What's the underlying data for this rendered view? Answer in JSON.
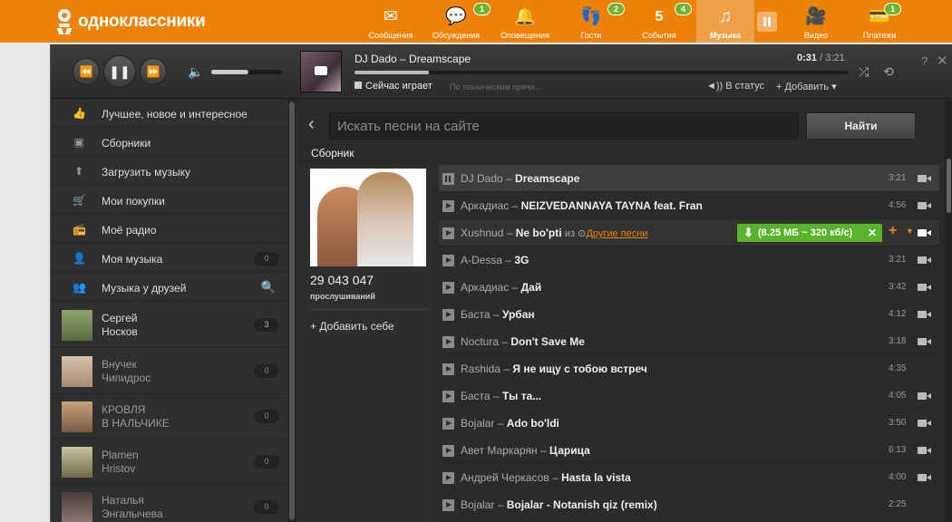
{
  "topbar": {
    "logo_text": "одноклассники",
    "nav": [
      {
        "label": "Сообщения",
        "badge": ""
      },
      {
        "label": "Обсуждения",
        "badge": "1"
      },
      {
        "label": "Оповещения",
        "badge": ""
      },
      {
        "label": "Гости",
        "badge": "2"
      },
      {
        "label": "События",
        "badge": "4",
        "icon_text": "5"
      },
      {
        "label": "Музыка",
        "badge": ""
      },
      {
        "label": "Видео",
        "badge": ""
      },
      {
        "label": "Платежи",
        "badge": "1"
      }
    ],
    "accent_color": "#ee8208"
  },
  "player": {
    "track_title": "DJ Dado – Dreamscape",
    "time_current": "0:31",
    "time_total": "/ 3:21",
    "progress": 0.15,
    "volume": 0.52,
    "now_playing": "Сейчас играет",
    "now_hint": "По техническим причи...",
    "to_status": "В статус",
    "add_label": "Добавить",
    "help": "?",
    "close": "✕"
  },
  "sidebar": {
    "items": [
      {
        "label": "Лучшее, новое и интересное",
        "icon": "thumbs-up-icon",
        "count": ""
      },
      {
        "label": "Сборники",
        "icon": "collection-icon",
        "count": ""
      },
      {
        "label": "Загрузить музыку",
        "icon": "upload-icon",
        "count": ""
      },
      {
        "label": "Мои покупки",
        "icon": "cart-icon",
        "count": ""
      },
      {
        "label": "Моё радио",
        "icon": "radio-icon",
        "count": ""
      },
      {
        "label": "Моя музыка",
        "icon": "user-music-icon",
        "count": "0"
      },
      {
        "label": "Музыка у друзей",
        "icon": "friends-icon",
        "count": ""
      }
    ],
    "friends": [
      {
        "line1": "Сергей",
        "line2": "Носков",
        "count": "3"
      },
      {
        "line1": "Внучек",
        "line2": "Чипидрос",
        "count": "0"
      },
      {
        "line1": "КРОВЛЯ",
        "line2": "В НАЛЬЧИКЕ",
        "count": "0"
      },
      {
        "line1": "Plamen",
        "line2": "Hristov",
        "count": "0"
      },
      {
        "line1": "Наталья",
        "line2": "Энгалычева",
        "count": "0"
      }
    ]
  },
  "main": {
    "search_placeholder": "Искать песни на сайте",
    "find_label": "Найти",
    "collection_label": "Сборник",
    "listens_count": "29 043 047",
    "listens_label": "прослушиваний",
    "add_self": "Добавить себе",
    "download": {
      "text": "(8.25 МБ ~ 320 кб/с)"
    },
    "tracks": [
      {
        "artist": "DJ Dado",
        "song": "Dreamscape",
        "duration": "3:21",
        "video": true
      },
      {
        "artist": "Аркадиас",
        "song": "NEIZVEDANNAYA TAYNA feat. Fran",
        "duration": "4:56",
        "video": true
      },
      {
        "artist": "Xushnud",
        "song": "Ne bo'pti",
        "from": "из",
        "other": "Другие песни",
        "duration": "",
        "video": true
      },
      {
        "artist": "A-Dessa",
        "song": "3G",
        "duration": "3:21",
        "video": true
      },
      {
        "artist": "Аркадиас",
        "song": "Дай",
        "duration": "3:42",
        "video": true
      },
      {
        "artist": "Баста",
        "song": "Урбан",
        "duration": "4:12",
        "video": true
      },
      {
        "artist": "Noctura",
        "song": "Don't Save Me",
        "duration": "3:18",
        "video": true
      },
      {
        "artist": "Rashida",
        "song": "Я не ищу с тобою встреч",
        "duration": "4:35",
        "video": false
      },
      {
        "artist": "Баста",
        "song": "Ты та...",
        "duration": "4:05",
        "video": true
      },
      {
        "artist": "Bojalar",
        "song": "Ado bo'ldi",
        "duration": "3:50",
        "video": true
      },
      {
        "artist": "Авет Маркарян",
        "song": "Царица",
        "duration": "6:13",
        "video": true
      },
      {
        "artist": "Андрей Черкасов",
        "song": "Hasta la vista",
        "duration": "4:00",
        "video": true
      },
      {
        "artist": "Bojalar",
        "song": "Bojalar - Notanish qiz (remix)",
        "duration": "2:25",
        "video": false
      }
    ]
  }
}
